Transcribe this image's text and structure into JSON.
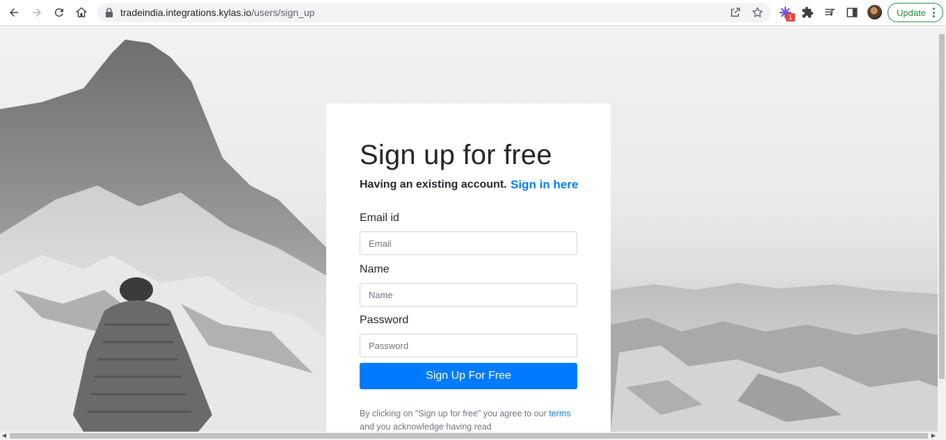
{
  "browser": {
    "url_host": "tradeindia.integrations.kylas.io",
    "url_path": "/users/sign_up",
    "extension_badge": "1",
    "update_label": "Update",
    "icons": [
      "back-icon",
      "forward-icon",
      "reload-icon",
      "home-icon",
      "lock-icon",
      "share-icon",
      "star-icon",
      "extension-icon",
      "puzzle-icon",
      "media-icon",
      "side-panel-icon"
    ]
  },
  "signup": {
    "title": "Sign up for free",
    "existing_text": "Having an existing account.",
    "signin_link": "Sign in here",
    "email_label": "Email id",
    "email_placeholder": "Email",
    "name_label": "Name",
    "name_placeholder": "Name",
    "password_label": "Password",
    "password_placeholder": "Password",
    "submit_label": "Sign Up For Free",
    "legal_prefix": "By clicking on \"Sign up for free\" you agree to our",
    "legal_terms_link": "terms",
    "legal_suffix": "and you acknowledge having read"
  },
  "colors": {
    "primary": "#007bff",
    "update_green": "#1e8e3e",
    "badge_red": "#e8453c"
  }
}
